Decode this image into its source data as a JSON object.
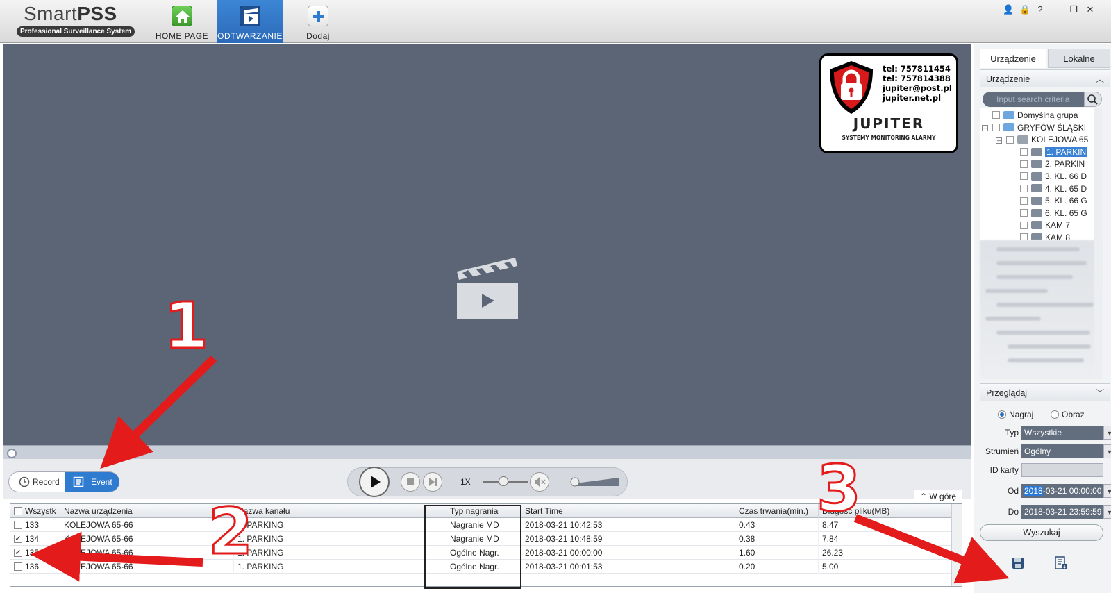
{
  "app": {
    "logo_prefix": "Smart",
    "logo_suffix": "PSS",
    "logo_subtitle": "Professional Surveillance System"
  },
  "nav": [
    {
      "label": "HOME PAGE",
      "icon": "home-icon",
      "active": false
    },
    {
      "label": "ODTWARZANIE",
      "icon": "playback-icon",
      "active": true
    },
    {
      "label": "Dodaj",
      "icon": "plus-icon",
      "active": false
    }
  ],
  "window_controls": [
    "user-icon",
    "lock-icon",
    "help-icon",
    "minimize-icon",
    "restore-icon",
    "close-icon"
  ],
  "window_glyphs": [
    "👤",
    "🔒",
    "?",
    "–",
    "❐",
    "✕"
  ],
  "overlay": {
    "phone1": "tel: 757811454",
    "phone2": "tel: 757814388",
    "email": "jupiter@post.pl",
    "web": "jupiter.net.pl",
    "brand": "JUPITER",
    "tagline": "SYSTEMY MONITORING ALARMY"
  },
  "controls": {
    "record_label": "Record",
    "event_label": "Event",
    "speed": "1X",
    "speed_level": 0.45,
    "back_to_top": "W górę"
  },
  "table": {
    "headers": [
      "Wszystk",
      "Nazwa urządzenia",
      "Nazwa kanału",
      "Typ nagrania",
      "Start Time",
      "Czas trwania(min.)",
      "Długość pliku(MB)"
    ],
    "rows": [
      {
        "checked": false,
        "num": "133",
        "device": "KOLEJOWA 65-66",
        "channel": "1. PARKING",
        "type": "Nagranie MD",
        "start": "2018-03-21 10:42:53",
        "duration": "0.43",
        "size": "8.47"
      },
      {
        "checked": true,
        "num": "134",
        "device": "KOLEJOWA 65-66",
        "channel": "1. PARKING",
        "type": "Nagranie MD",
        "start": "2018-03-21 10:48:59",
        "duration": "0.38",
        "size": "7.84"
      },
      {
        "checked": true,
        "num": "135",
        "device": "KOLEJOWA 65-66",
        "channel": "1. PARKING",
        "type": "Ogólne Nagr.",
        "start": "2018-03-21 00:00:00",
        "duration": "1.60",
        "size": "26.23"
      },
      {
        "checked": false,
        "num": "136",
        "device": "KOLEJOWA 65-66",
        "channel": "1. PARKING",
        "type": "Ogólne Nagr.",
        "start": "2018-03-21 00:01:53",
        "duration": "0.20",
        "size": "5.00"
      }
    ]
  },
  "sidebar": {
    "tab_device": "Urządzenie",
    "tab_local": "Lokalne",
    "section_device": "Urządzenie",
    "search_placeholder": "Input search criteria",
    "tree": [
      {
        "label": "Domyślna grupa",
        "level": 0,
        "icon": "folder"
      },
      {
        "label": "GRYFÓW ŚLĄSKI",
        "level": 0,
        "icon": "folder",
        "expander": "–"
      },
      {
        "label": "KOLEJOWA 65",
        "level": 1,
        "icon": "dvr",
        "expander": "–"
      },
      {
        "label": "1. PARKIN",
        "level": 2,
        "icon": "camera",
        "selected": true
      },
      {
        "label": "2. PARKIN",
        "level": 2,
        "icon": "camera"
      },
      {
        "label": "3. KL. 66 D",
        "level": 2,
        "icon": "camera"
      },
      {
        "label": "4. KL. 65 D",
        "level": 2,
        "icon": "camera"
      },
      {
        "label": "5. KL. 66 G",
        "level": 2,
        "icon": "camera"
      },
      {
        "label": "6. KL. 65 G",
        "level": 2,
        "icon": "camera"
      },
      {
        "label": "KAM 7",
        "level": 2,
        "icon": "camera"
      },
      {
        "label": "KAM 8",
        "level": 2,
        "icon": "camera"
      }
    ],
    "section_browse": "Przeglądaj",
    "radio_record": "Nagraj",
    "radio_image": "Obraz",
    "type_label": "Typ",
    "type_value": "Wszystkie",
    "stream_label": "Strumień",
    "stream_value": "Ogólny",
    "card_label": "ID karty",
    "from_label": "Od",
    "from_highlight": "2018",
    "from_rest": "-03-21 00:00:00",
    "to_label": "Do",
    "to_value": "2018-03-21 23:59:59",
    "search_button": "Wyszukaj"
  },
  "annotations": [
    "1",
    "2",
    "3"
  ],
  "colors": {
    "accent": "#2e7bd0",
    "video_bg": "#5b6576",
    "annotation": "#e31b1b"
  }
}
